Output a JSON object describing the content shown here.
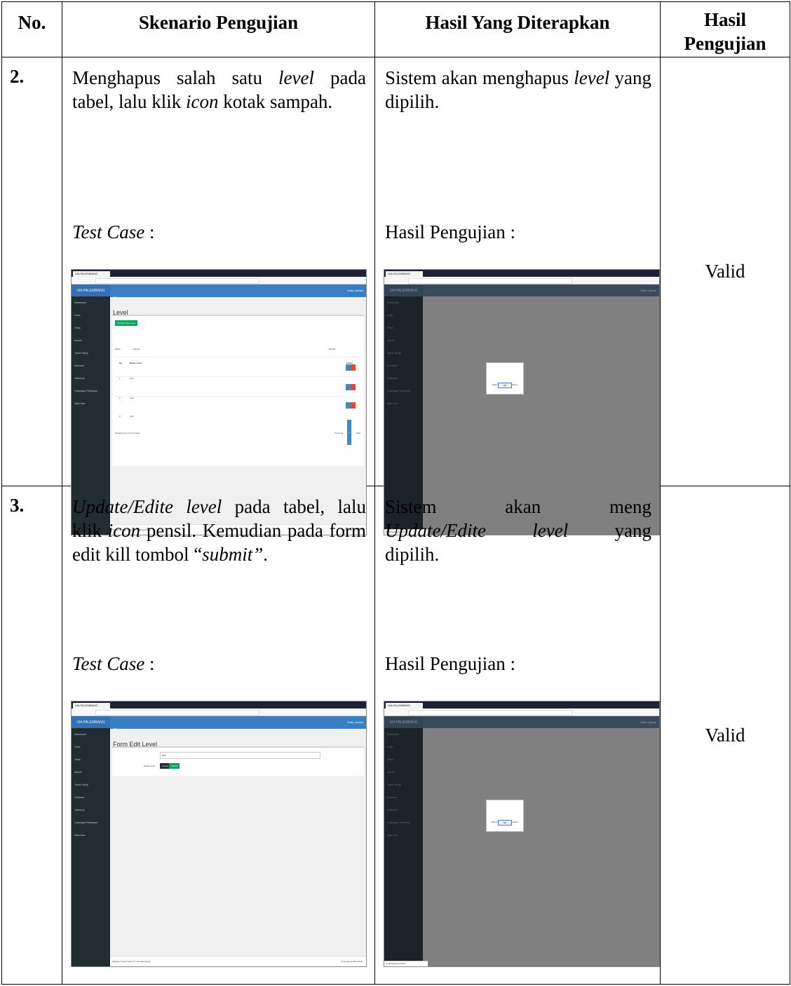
{
  "table": {
    "headers": {
      "no": "No.",
      "skenario": "Skenario Pengujian",
      "hasil_diterapkan": "Hasil Yang Diterapkan",
      "hasil_pengujian_line1": "Hasil",
      "hasil_pengujian_line2": "Pengujian"
    },
    "rows": [
      {
        "no": "2.",
        "skenario": {
          "t1": "Menghapus salah satu ",
          "t2": "level",
          "t3": " pada tabel, lalu klik ",
          "t4": "icon",
          "t5": " kotak sampah."
        },
        "test_case_label": "Test Case",
        "test_case_colon": " :",
        "hasil": {
          "t1": "Sistem akan menghapus ",
          "t2": "level",
          "t3": " yang dipilih."
        },
        "hasil_label": "Hasil Pengujian :",
        "status": "Valid"
      },
      {
        "no": "3.",
        "skenario": {
          "t1": "Update/Edite level",
          "t2": " pada tabel, lalu klik ",
          "t3": "icon",
          "t4": " pensil. Kemudian pada form edit kill tombol “",
          "t5": "submit”",
          "t6": "."
        },
        "test_case_label": "Test Case",
        "test_case_colon": " :",
        "hasil": {
          "w1": "Sistem",
          "w2": "akan",
          "w3": "meng",
          "t4": "Update/Edite",
          "t5": "level",
          "t6": "yang",
          "t7": "dipilih."
        },
        "hasil_label": "Hasil Pengujian :",
        "status": "Valid"
      }
    ]
  },
  "screenshots": {
    "tab_title": "UIA PALEMBANG",
    "brand": "UIA PALEMBANG",
    "hello": "Hello, Admin",
    "sidebar": [
      "Dashboard",
      "Level",
      "Tema",
      "Alumni",
      "Tracer Study",
      "Kuisioner",
      "Testimoni",
      "Lowongan Pekerjaan",
      "Data User"
    ],
    "level_page": {
      "title": "Level",
      "add_button": "Tambah Data Level",
      "show": "Show",
      "entries": "entries",
      "search": "Search:",
      "col_no": "No",
      "col_nama": "Nama Level",
      "col_action": "Action",
      "rows": [
        {
          "no": "1",
          "nama": "ALU"
        },
        {
          "no": "2",
          "nama": "ALU"
        },
        {
          "no": "3",
          "nama": "ALU"
        }
      ],
      "showing": "Showing 1 to 3 of 3 entries",
      "prev": "Previous",
      "page": "1",
      "next": "Next"
    },
    "delete_dialog": {
      "message": "Data level berhasil dihapus",
      "ok": "OK"
    },
    "edit_page": {
      "title": "Form Edit Level",
      "label": "Nama Level",
      "value": "ALU",
      "cancel": "Cancel",
      "submit": "Submit"
    },
    "update_dialog": {
      "message": "Data level berhasil diperbarui",
      "ok": "OK"
    },
    "footer_left": "Website Tracer Study (© UIA Palembang",
    "footer_right": "Powered by Pika Admin",
    "status_url": "localhost/tracer/admin"
  },
  "colors": {
    "sidebar": "#222d32",
    "appbar": "#3b7fc3",
    "overlay": "#808080",
    "success": "#00a65a"
  }
}
